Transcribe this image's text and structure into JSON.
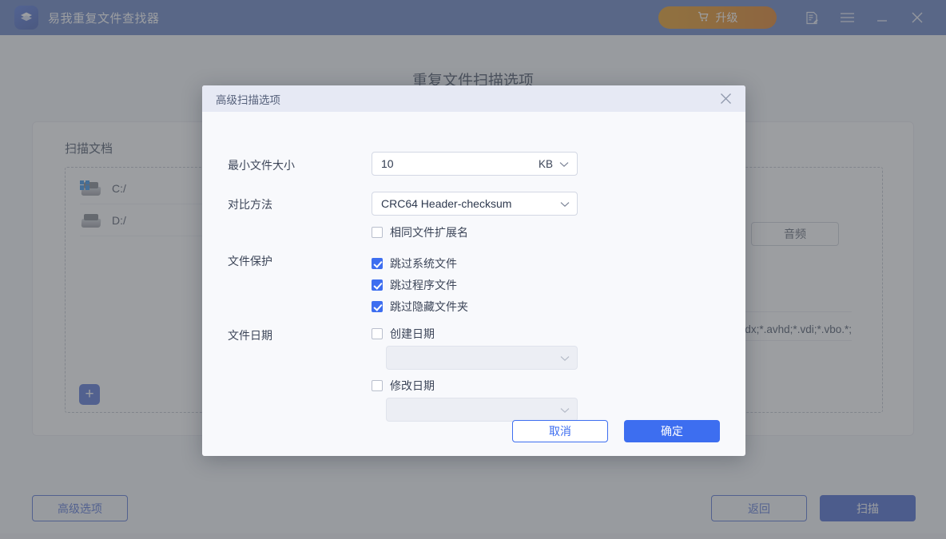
{
  "titlebar": {
    "app_name": "易我重复文件查找器",
    "logo_icon": "layers-logo-icon",
    "upgrade_label": "升级",
    "upgrade_icon": "shopping-cart-icon",
    "upgrade_color": "#d96a00",
    "icons": [
      {
        "name": "feedback-icon"
      },
      {
        "name": "menu-hamburger-icon"
      },
      {
        "name": "minimize-icon"
      },
      {
        "name": "close-icon"
      }
    ]
  },
  "page": {
    "title": "重复文件扫描选项",
    "card_title": "扫描文档",
    "drives": [
      {
        "label": "C:/",
        "icon": "windows-drive-icon"
      },
      {
        "label": "D:/",
        "icon": "hard-drive-icon"
      }
    ],
    "add_button_label": "+",
    "filter_buttons": [
      {
        "label": ""
      },
      {
        "label": "音频"
      }
    ],
    "extensions_text": ";*.vhdx;*.avhd;*.vdi;*.vbo"
  },
  "footer": {
    "advanced_options_label": "高级选项",
    "back_label": "返回",
    "scan_label": "扫描",
    "accent_color": "#3d5fd0"
  },
  "dialog": {
    "title": "高级扫描选项",
    "close_icon": "close-icon",
    "min_file_size": {
      "label": "最小文件大小",
      "value": "10",
      "unit": "KB",
      "chevron_icon": "chevron-down-icon"
    },
    "compare_method": {
      "label": "对比方法",
      "value": "CRC64 Header-checksum",
      "chevron_icon": "chevron-down-icon",
      "same_extension": {
        "label": "相同文件扩展名",
        "checked": false
      }
    },
    "file_protection": {
      "label": "文件保护",
      "options": [
        {
          "label": "跳过系统文件",
          "checked": true
        },
        {
          "label": "跳过程序文件",
          "checked": true
        },
        {
          "label": "跳过隐藏文件夹",
          "checked": true
        }
      ]
    },
    "file_date": {
      "label": "文件日期",
      "created": {
        "label": "创建日期",
        "checked": false,
        "value": "",
        "disabled": true
      },
      "modified": {
        "label": "修改日期",
        "checked": false,
        "value": "",
        "disabled": true
      }
    },
    "cancel_label": "取消",
    "confirm_label": "确定",
    "accent_color": "#3d6ef0"
  }
}
